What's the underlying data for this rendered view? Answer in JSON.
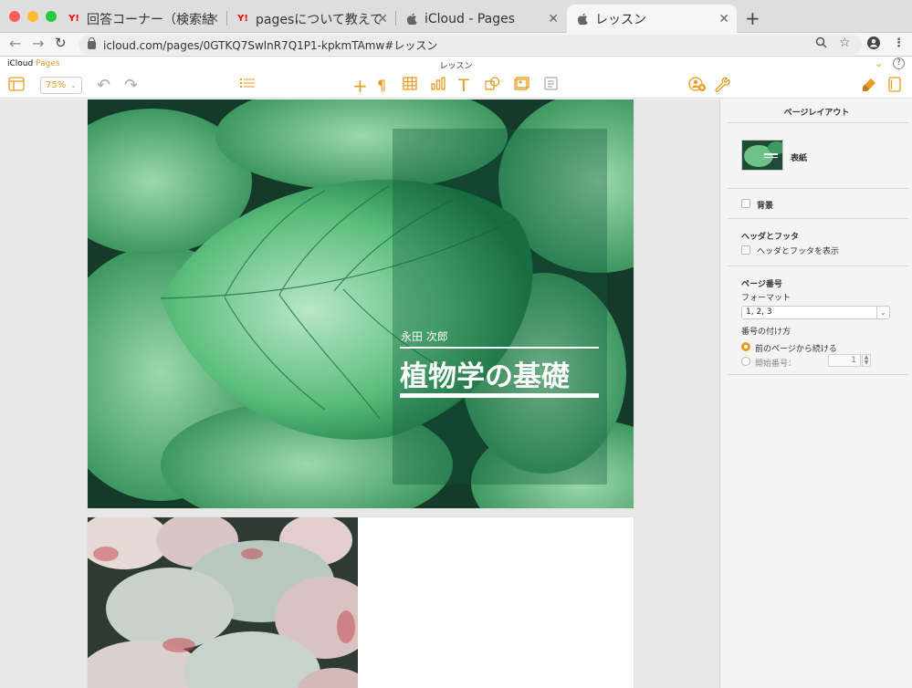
{
  "browser": {
    "tabs": [
      {
        "favicon": "Y!",
        "title": "回答コーナー（検索結果"
      },
      {
        "favicon": "Y!",
        "title": "pagesについて教えてく"
      },
      {
        "favicon": "apple-icon",
        "title": "iCloud - Pages"
      },
      {
        "favicon": "apple-icon",
        "title": "レッスン"
      }
    ],
    "url": "icloud.com/pages/0GTKQ7SwlnR7Q1P1-kpkmTAmw#レッスン"
  },
  "app": {
    "brand_icloud": "iCloud",
    "brand_pages": "Pages",
    "doc_title": "レッスン",
    "zoom": "75%",
    "accent": "#e89b20"
  },
  "cover": {
    "author": "永田 次郎",
    "title": "植物学の基礎"
  },
  "sidebar": {
    "title": "ページレイアウト",
    "cover_label": "表紙",
    "background_label": "背景",
    "hf_section": "ヘッダとフッタ",
    "hf_show_label": "ヘッダとフッタを表示",
    "pn_section": "ページ番号",
    "format_label": "フォーマット",
    "format_value": "1, 2, 3",
    "numbering_label": "番号の付け方",
    "continue_label": "前のページから続ける",
    "start_label": "開始番号：",
    "start_value": "1"
  }
}
